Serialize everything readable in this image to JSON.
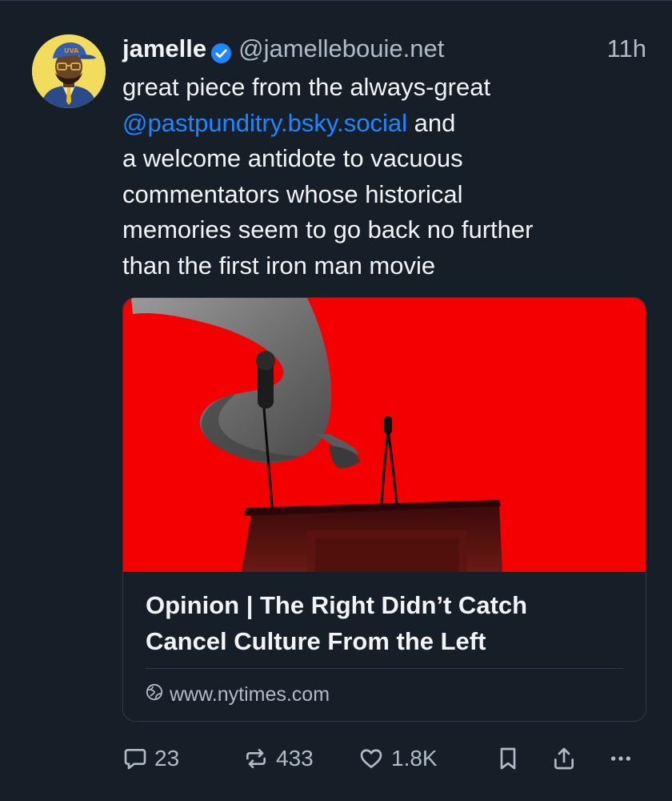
{
  "post": {
    "author": {
      "display_name": "jamelle",
      "handle": "@jamellebouie.net",
      "verified": true,
      "avatar_cap_text": "UVA"
    },
    "timestamp": "11h",
    "text_lines": [
      {
        "parts": [
          {
            "text": "great piece from the always-great",
            "type": "text"
          }
        ]
      },
      {
        "parts": [
          {
            "text": "@pastpunditry.bsky.social",
            "type": "mention"
          },
          {
            "text": " and",
            "type": "text"
          }
        ]
      },
      {
        "parts": [
          {
            "text": "a welcome antidote to vacuous",
            "type": "text"
          }
        ]
      },
      {
        "parts": [
          {
            "text": "commentators whose historical",
            "type": "text"
          }
        ]
      },
      {
        "parts": [
          {
            "text": "memories seem to go back no further",
            "type": "text"
          }
        ]
      },
      {
        "parts": [
          {
            "text": "than the first iron man movie",
            "type": "text"
          }
        ]
      }
    ],
    "embed": {
      "image": "elephant trunk holding microphone over podium on red background",
      "title_lines": [
        "Opinion | The Right Didn’t Catch",
        "Cancel Culture From the Left"
      ],
      "domain": "www.nytimes.com"
    },
    "actions": {
      "replies": "23",
      "reposts": "433",
      "likes": "1.8K"
    }
  },
  "colors": {
    "background": "#161e27",
    "text": "#f1f3f5",
    "muted": "#aebbc9",
    "link": "#2086ff",
    "border": "#2e3a47",
    "image_red": "#f40000",
    "avatar_yellow": "#f2dc5d"
  },
  "icons": [
    "verified-badge-icon",
    "globe-icon",
    "reply-icon",
    "repost-icon",
    "like-icon",
    "bookmark-icon",
    "share-icon",
    "more-icon"
  ]
}
